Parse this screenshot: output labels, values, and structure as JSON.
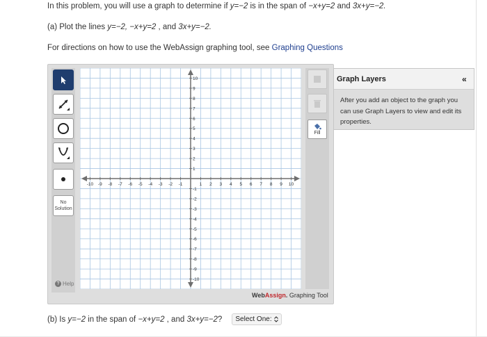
{
  "problem": {
    "intro_a": "In this problem, you will use a graph to determine if ",
    "intro_eq1": "y=−2",
    "intro_b": " is in the span of ",
    "intro_eq2": "−x+y=2",
    "intro_c": " and ",
    "intro_eq3": "3x+y=−2.",
    "part_a_prefix": "(a) Plot the lines ",
    "part_a_eq1": "y=−2,",
    "part_a_eq2": "−x+y=2",
    "part_a_mid": " , and ",
    "part_a_eq3": "3x+y=−2.",
    "directions_text": "For directions on how to use the WebAssign graphing tool, see ",
    "directions_link": "Graphing Questions",
    "part_b_prefix": "(b) Is ",
    "part_b_eq1": "y=−2",
    "part_b_mid1": " in the span of ",
    "part_b_eq2": "−x+y=2",
    "part_b_mid2": " , and ",
    "part_b_eq3": "3x+y=−2",
    "part_b_q": "?",
    "select_value": "Select One:"
  },
  "tools": {
    "no_solution_line1": "No",
    "no_solution_line2": "Solution",
    "help": "Help",
    "fill": "Fill",
    "brand_web": "Web",
    "brand_assign": "Assign",
    "brand_dot": ".",
    "brand_tool": " Graphing Tool"
  },
  "layers": {
    "title": "Graph Layers",
    "collapse": "«",
    "body": "After you add an object to the graph you can use Graph Layers to view and edit its properties."
  },
  "graph": {
    "x_ticks": [
      "-10",
      "-9",
      "-8",
      "-7",
      "-6",
      "-5",
      "-4",
      "-3",
      "-2",
      "-1",
      "1",
      "2",
      "3",
      "4",
      "5",
      "6",
      "7",
      "8",
      "9",
      "10"
    ],
    "y_ticks": [
      "10",
      "9",
      "8",
      "7",
      "6",
      "5",
      "4",
      "3",
      "2",
      "1",
      "-1",
      "-2",
      "-3",
      "-4",
      "-5",
      "-6",
      "-7",
      "-8",
      "-9",
      "-10"
    ],
    "grid_color": "#a9c6e2",
    "axis_color": "#6f6f6f"
  },
  "colors": {
    "active_tool": "#1f3d6e",
    "link": "#1f3f8f",
    "brand_red": "#c0282d"
  }
}
